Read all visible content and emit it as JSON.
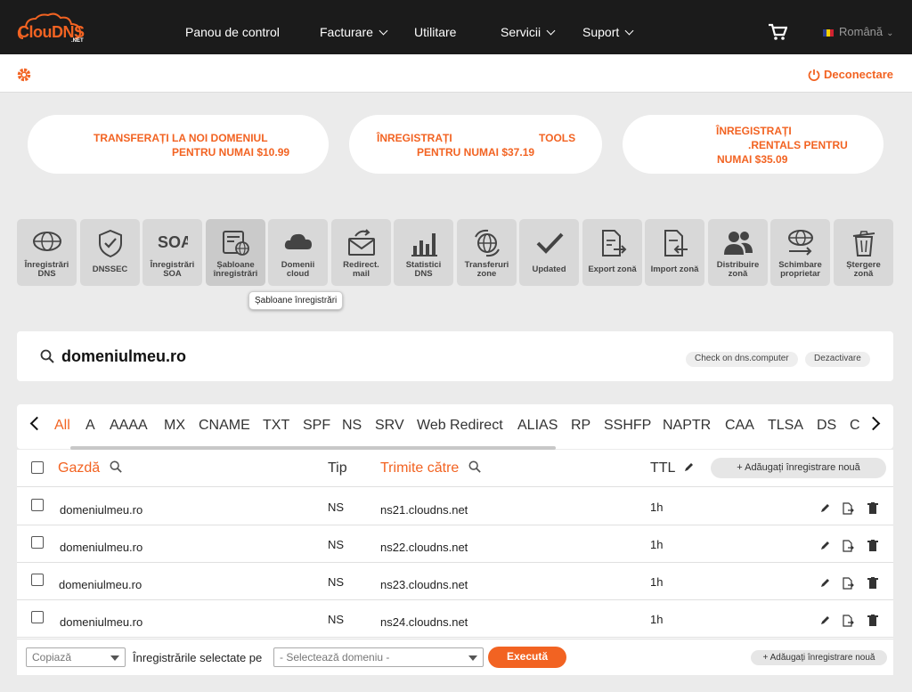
{
  "nav": {
    "logo_main": "ClouDNS",
    "logo_suffix": ".NET",
    "items": [
      "Panou de control",
      "Facturare",
      "Utilitare",
      "Servicii",
      "Suport"
    ],
    "language": "Română"
  },
  "subbar": {
    "logout": "Deconectare"
  },
  "promos": [
    {
      "line1": "TRANSFERAȚI LA NOI DOMENIUL",
      "line2": "PENTRU NUMAI $10.99"
    },
    {
      "line1a": "ÎNREGISTRAȚI",
      "line1b": "TOOLS",
      "line2": "PENTRU NUMAI $37.19"
    },
    {
      "line1": "ÎNREGISTRAȚI",
      "line2": ".RENTALS PENTRU",
      "line3": "NUMAI $35.09"
    }
  ],
  "tools": [
    {
      "l1": "Înregistrări",
      "l2": "DNS"
    },
    {
      "l1": "DNSSEC",
      "l2": ""
    },
    {
      "l1": "Înregistrări",
      "l2": "SOA"
    },
    {
      "l1": "Șabloane",
      "l2": "înregistrări"
    },
    {
      "l1": "Domenii",
      "l2": "cloud"
    },
    {
      "l1": "Redirect.",
      "l2": "mail"
    },
    {
      "l1": "Statistici",
      "l2": "DNS"
    },
    {
      "l1": "Transferuri",
      "l2": "zone"
    },
    {
      "l1": "Updated",
      "l2": ""
    },
    {
      "l1": "Export zonă",
      "l2": ""
    },
    {
      "l1": "Import zonă",
      "l2": ""
    },
    {
      "l1": "Distribuire",
      "l2": "zonă"
    },
    {
      "l1": "Schimbare",
      "l2": "proprietar"
    },
    {
      "l1": "Ștergere",
      "l2": "zonă"
    }
  ],
  "soa_icon_text": "SOA",
  "tooltip": "Șabloane înregistrări",
  "domain": {
    "name": "domeniulmeu.ro",
    "check_label": "Check on dns.computer",
    "disable_label": "Dezactivare"
  },
  "record_tabs": [
    "All",
    "A",
    "AAAA",
    "MX",
    "CNAME",
    "TXT",
    "SPF",
    "NS",
    "SRV",
    "Web Redirect",
    "ALIAS",
    "RP",
    "SSHFP",
    "NAPTR",
    "CAA",
    "TLSA",
    "DS",
    "C"
  ],
  "table": {
    "headers": {
      "host": "Gazdă",
      "type": "Tip",
      "points_to": "Trimite către",
      "ttl": "TTL"
    },
    "add_label": "+ Adăugați înregistrare nouă",
    "rows": [
      {
        "host": "domeniulmeu.ro",
        "type": "NS",
        "points_to": "ns21.cloudns.net",
        "ttl": "1h"
      },
      {
        "host": "domeniulmeu.ro",
        "type": "NS",
        "points_to": "ns22.cloudns.net",
        "ttl": "1h"
      },
      {
        "host": "domeniulmeu.ro",
        "type": "NS",
        "points_to": "ns23.cloudns.net",
        "ttl": "1h"
      },
      {
        "host": "domeniulmeu.ro",
        "type": "NS",
        "points_to": "ns24.cloudns.net",
        "ttl": "1h"
      }
    ]
  },
  "footer": {
    "action_select": "Copiază",
    "selected_label": "Înregistrările selectate pe",
    "domain_select": "- Selectează domeniu -",
    "execute": "Execută",
    "add_label": "+ Adăugați înregistrare nouă"
  },
  "colors": {
    "accent": "#f26322",
    "nav_bg": "#1b1b1b",
    "page_bg": "#ebebeb"
  }
}
